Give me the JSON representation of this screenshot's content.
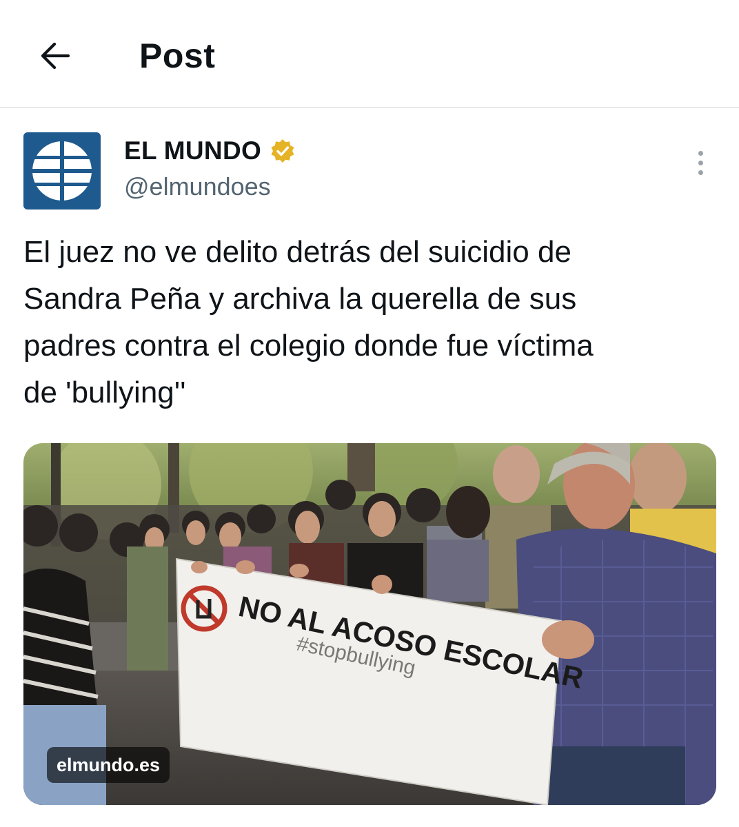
{
  "header": {
    "title": "Post",
    "back_icon": "arrow-left-icon"
  },
  "tweet": {
    "author": {
      "display_name": "EL MUNDO",
      "handle": "@elmundoes",
      "verified_badge": "gold-verified-icon",
      "avatar_color": "#1e5a8e"
    },
    "text": "El juez no ve delito detrás del suicidio de\nSandra Peña y archiva la querella de sus\npadres contra el colegio donde fue víctima\nde 'bullying''",
    "more_icon": "more-vertical-icon",
    "media": {
      "source_label": "elmundo.es",
      "banner_line1": "NO AL ACOSO ESCOLAR",
      "banner_line2": "#stopbullying"
    }
  },
  "colors": {
    "text": "#0f1419",
    "secondary": "#536471",
    "gold_badge": "#e5b325",
    "divider": "#e6e9eb"
  }
}
